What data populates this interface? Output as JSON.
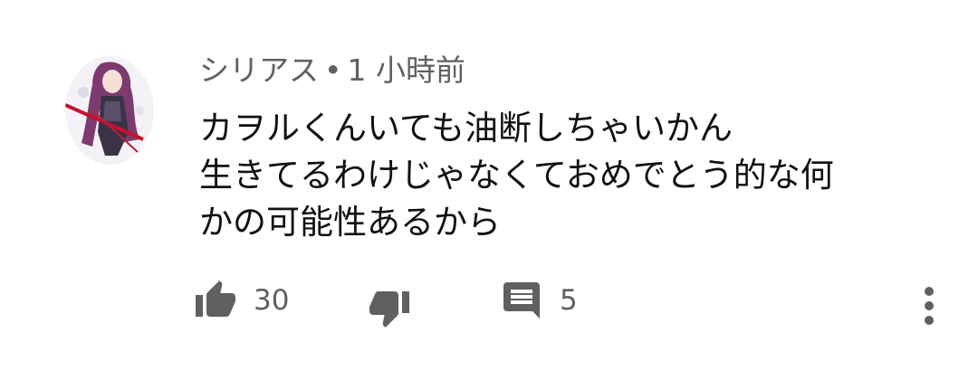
{
  "comment": {
    "author": "シリアス",
    "separator": "•",
    "time": "1 小時前",
    "text_lines": [
      "カヲルくんいても油断しちゃいかん",
      "生きてるわけじゃなくておめでとう的な何",
      "かの可能性あるから"
    ],
    "like_count": "30",
    "reply_count": "5"
  },
  "icons": {
    "avatar": "avatar",
    "like": "thumb-up-icon",
    "dislike": "thumb-down-icon",
    "reply": "comment-icon",
    "more": "more-vert-icon"
  },
  "colors": {
    "meta_text": "#606060",
    "body_text": "#111111",
    "icon": "#606060"
  }
}
